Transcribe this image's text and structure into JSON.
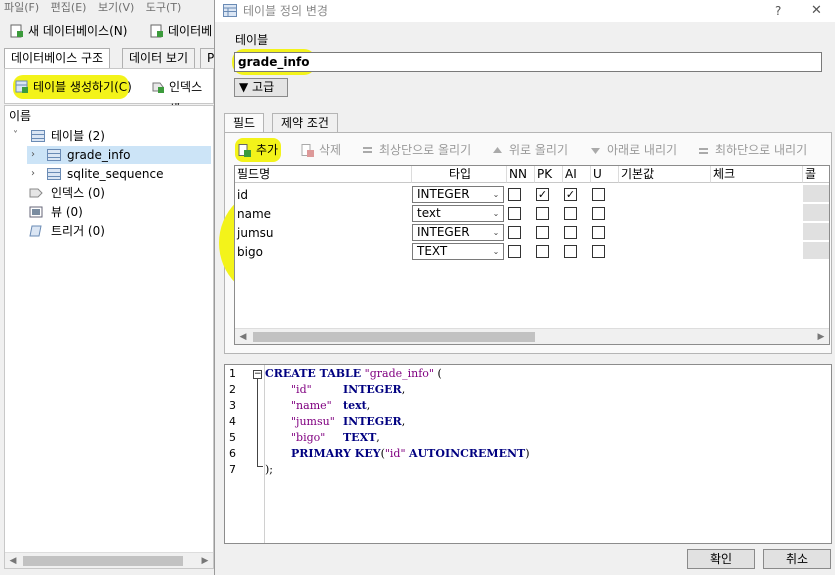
{
  "main": {
    "menu": [
      "파일(F)",
      "편집(E)",
      "보기(V)",
      "도구(T)"
    ],
    "toolbar": {
      "new_db": "새 데이터베이스(N)",
      "open_db": "데이터베"
    },
    "tabs": [
      "데이터베이스 구조",
      "데이터 보기",
      "P"
    ],
    "actions": {
      "create_table": "테이블 생성하기(C)",
      "create_index": "인덱스 생"
    },
    "tree": {
      "header": "이름",
      "tables_label": "테이블 (2)",
      "tables": [
        "grade_info",
        "sqlite_sequence"
      ],
      "indexes_label": "인덱스 (0)",
      "views_label": "뷰 (0)",
      "triggers_label": "트리거 (0)"
    }
  },
  "dialog": {
    "title": "테이블 정의 변경",
    "help": "?",
    "close": "✕",
    "table_label": "테이블",
    "table_name": "grade_info",
    "advanced_button": "▼ 고급",
    "tabs": [
      "필드",
      "제약 조건"
    ],
    "field_actions": {
      "add": "추가",
      "delete": "삭제",
      "move_top": "최상단으로 올리기",
      "move_up": "위로 올리기",
      "move_down": "아래로 내리기",
      "move_bottom": "최하단으로 내리기"
    },
    "columns": [
      "필드명",
      "타입",
      "NN",
      "PK",
      "AI",
      "U",
      "기본값",
      "체크",
      "콜"
    ],
    "fields": [
      {
        "name": "id",
        "type": "INTEGER",
        "nn": false,
        "pk": true,
        "ai": true,
        "u": false
      },
      {
        "name": "name",
        "type": "text",
        "nn": false,
        "pk": false,
        "ai": false,
        "u": false
      },
      {
        "name": "jumsu",
        "type": "INTEGER",
        "nn": false,
        "pk": false,
        "ai": false,
        "u": false
      },
      {
        "name": "bigo",
        "type": "TEXT",
        "nn": false,
        "pk": false,
        "ai": false,
        "u": false
      }
    ],
    "sql_line_numbers": [
      "1",
      "2",
      "3",
      "4",
      "5",
      "6",
      "7"
    ],
    "fold_marker": "−",
    "sql": {
      "l1": {
        "kw": "CREATE TABLE",
        "name": "\"grade_info\"",
        "paren": " ("
      },
      "l2": {
        "col": "\"id\"",
        "type": "INTEGER",
        "end": ","
      },
      "l3": {
        "col": "\"name\"",
        "type": "text",
        "end": ","
      },
      "l4": {
        "col": "\"jumsu\"",
        "type": "INTEGER",
        "end": ","
      },
      "l5": {
        "col": "\"bigo\"",
        "type": "TEXT",
        "end": ","
      },
      "l6": {
        "kw": "PRIMARY KEY",
        "open": "(",
        "col": "\"id\"",
        "kw2": "AUTOINCREMENT",
        "close": ")"
      },
      "l7": ");"
    },
    "ok_button": "확인",
    "cancel_button": "취소"
  },
  "colors": {
    "highlight": "#f3f31a",
    "keyword": "#000080",
    "string": "#800080"
  }
}
